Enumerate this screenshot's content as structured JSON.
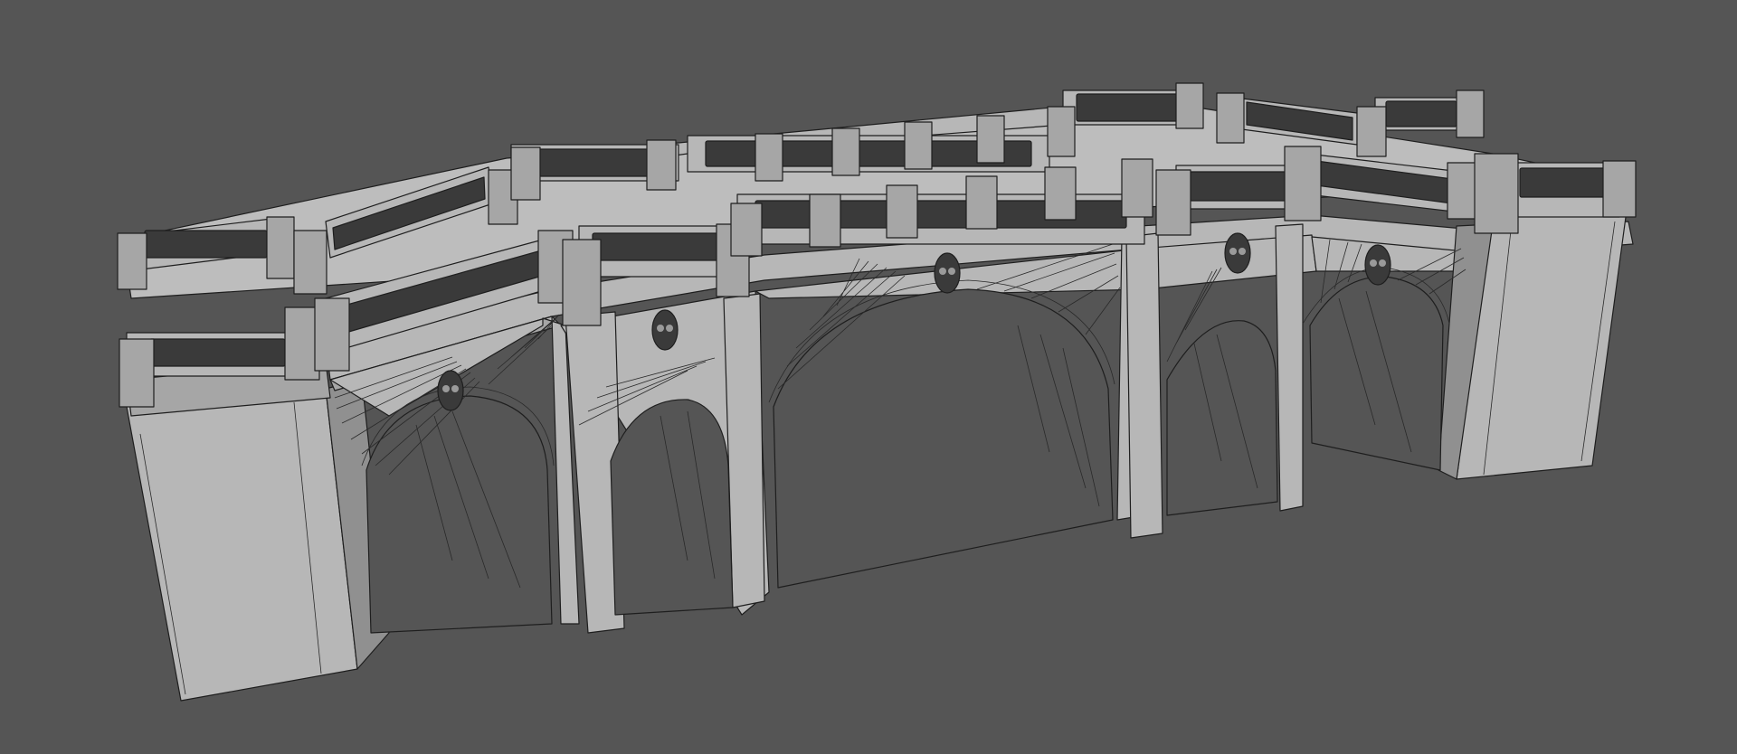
{
  "viewport": {
    "background": "#555555",
    "model_fill": "#b7b7b7",
    "wire_color": "#1e1e1e"
  },
  "model": {
    "icon": "bridge-wireframe-icon"
  }
}
